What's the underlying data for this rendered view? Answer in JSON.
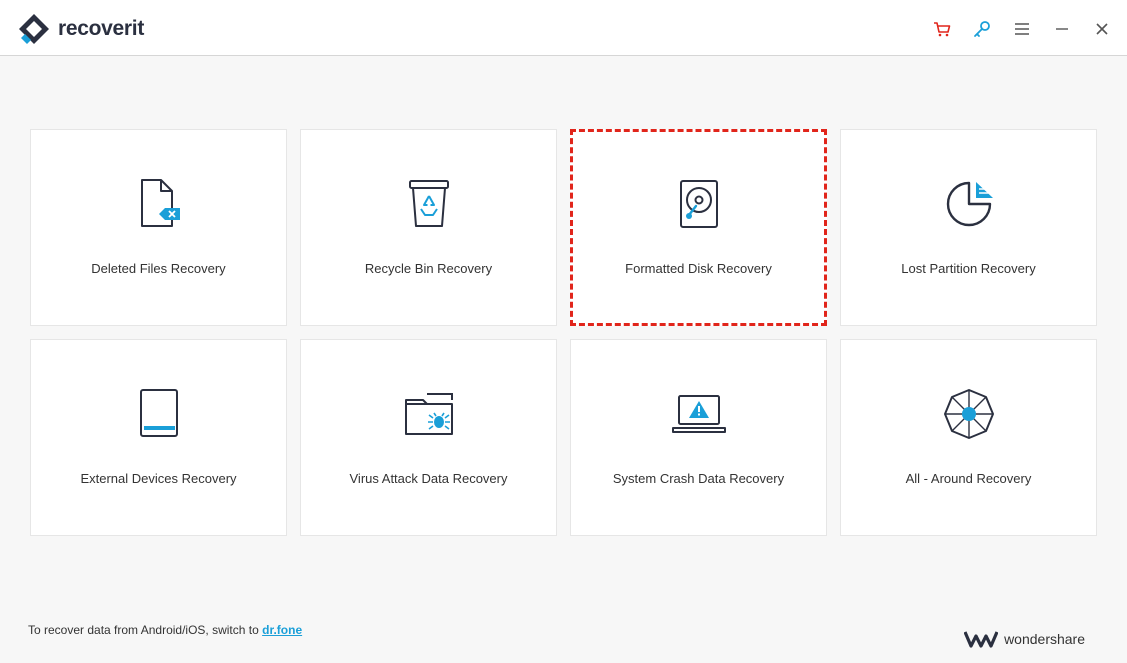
{
  "app": {
    "name_part1": "recover",
    "name_part2": "it",
    "accent": "#1a9fd8",
    "dark": "#2b3040",
    "highlight": "#e1251b"
  },
  "window_controls": {
    "icons": [
      "cart-icon",
      "key-icon",
      "menu-icon",
      "minimize-icon",
      "close-icon"
    ]
  },
  "modes": [
    {
      "label": "Deleted Files Recovery",
      "icon": "deleted-file-icon",
      "selected": false
    },
    {
      "label": "Recycle Bin Recovery",
      "icon": "recycle-bin-icon",
      "selected": false
    },
    {
      "label": "Formatted Disk Recovery",
      "icon": "hard-disk-icon",
      "selected": true
    },
    {
      "label": "Lost Partition Recovery",
      "icon": "partition-pie-icon",
      "selected": false
    },
    {
      "label": "External Devices Recovery",
      "icon": "external-device-icon",
      "selected": false
    },
    {
      "label": "Virus Attack Data Recovery",
      "icon": "virus-folder-icon",
      "selected": false
    },
    {
      "label": "System Crash Data Recovery",
      "icon": "crashed-laptop-icon",
      "selected": false
    },
    {
      "label": "All - Around Recovery",
      "icon": "all-around-icon",
      "selected": false
    }
  ],
  "footer": {
    "note": "To recover data from Android/iOS, switch to ",
    "link": "dr.fone",
    "brand": "wondershare"
  }
}
